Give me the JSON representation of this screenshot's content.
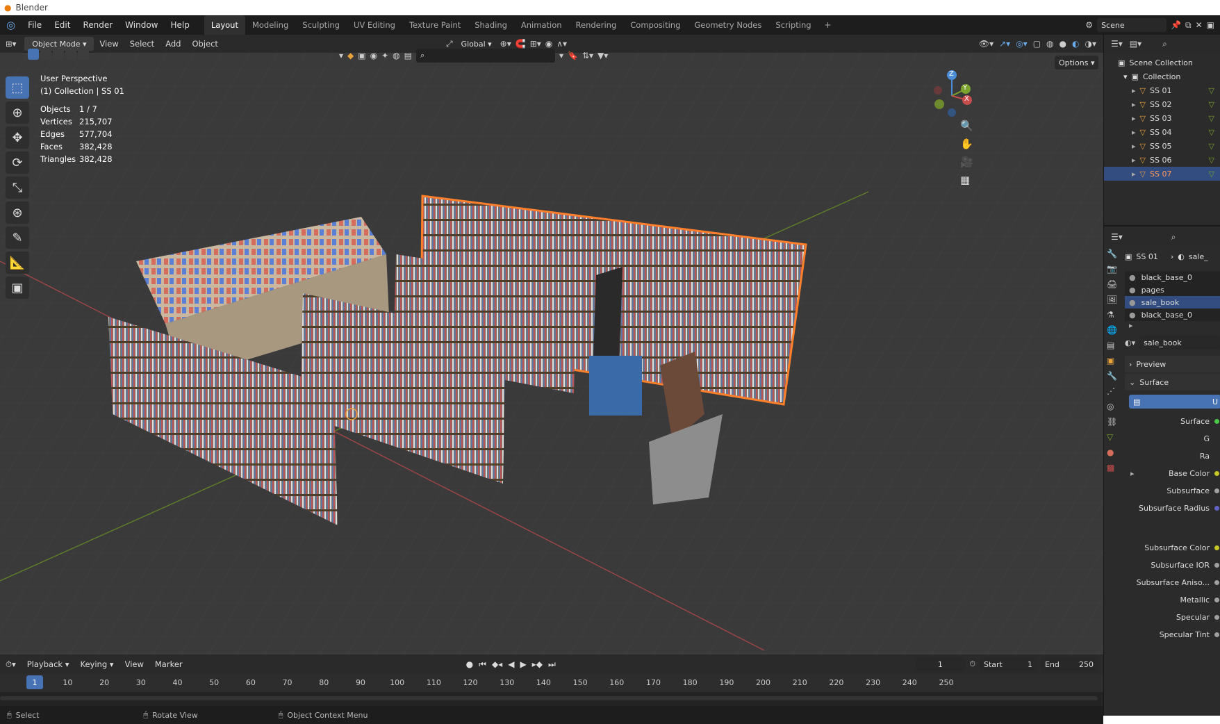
{
  "app_title": "Blender",
  "menu": [
    "File",
    "Edit",
    "Render",
    "Window",
    "Help"
  ],
  "workspaces": [
    "Layout",
    "Modeling",
    "Sculpting",
    "UV Editing",
    "Texture Paint",
    "Shading",
    "Animation",
    "Rendering",
    "Compositing",
    "Geometry Nodes",
    "Scripting"
  ],
  "active_workspace": "Layout",
  "scene_name": "Scene",
  "viewport_header": {
    "mode": "Object Mode",
    "menus": [
      "View",
      "Select",
      "Add",
      "Object"
    ],
    "orientation": "Global",
    "options": "Options"
  },
  "overlay": {
    "perspective": "User Perspective",
    "context": "(1) Collection | SS 01",
    "stats": [
      {
        "k": "Objects",
        "v": "1 / 7"
      },
      {
        "k": "Vertices",
        "v": "215,707"
      },
      {
        "k": "Edges",
        "v": "577,704"
      },
      {
        "k": "Faces",
        "v": "382,428"
      },
      {
        "k": "Triangles",
        "v": "382,428"
      }
    ]
  },
  "gizmo": {
    "z": "Z",
    "y": "Y",
    "x": "X"
  },
  "outliner": {
    "root": "Scene Collection",
    "collection": "Collection",
    "objects": [
      "SS 01",
      "SS 02",
      "SS 03",
      "SS 04",
      "SS 05",
      "SS 06",
      "SS 07"
    ],
    "selected": "SS 07"
  },
  "properties": {
    "breadcrumb_object": "SS 01",
    "breadcrumb_material": "sale_",
    "material_slots": [
      "black_base_0",
      "pages",
      "sale_book",
      "black_base_0"
    ],
    "active_slot": "sale_book",
    "material_name": "sale_book",
    "panels": {
      "preview": "Preview",
      "surface": "Surface"
    },
    "surface_field": "U",
    "inputs": [
      {
        "label": "Surface",
        "socket": "green"
      },
      {
        "label": "",
        "value": "G"
      },
      {
        "label": "",
        "value": "Ra"
      },
      {
        "label": "Base Color",
        "socket": "yellow"
      },
      {
        "label": "Subsurface",
        "socket": "gray"
      },
      {
        "label": "Subsurface Radius",
        "socket": "blue"
      },
      {
        "label": "Subsurface Color",
        "socket": "yellow"
      },
      {
        "label": "Subsurface IOR",
        "socket": "gray"
      },
      {
        "label": "Subsurface Aniso...",
        "socket": "gray"
      },
      {
        "label": "Metallic",
        "socket": "gray"
      },
      {
        "label": "Specular",
        "socket": "gray"
      },
      {
        "label": "Specular Tint",
        "socket": "gray"
      }
    ]
  },
  "timeline": {
    "menus": [
      "Playback",
      "Keying",
      "View",
      "Marker"
    ],
    "current_frame": "1",
    "start_label": "Start",
    "start": "1",
    "end_label": "End",
    "end": "250",
    "ticks": [
      "1",
      "10",
      "20",
      "30",
      "40",
      "50",
      "60",
      "70",
      "80",
      "90",
      "100",
      "110",
      "120",
      "130",
      "140",
      "150",
      "160",
      "170",
      "180",
      "190",
      "200",
      "210",
      "220",
      "230",
      "240",
      "250"
    ]
  },
  "statusbar": {
    "select": "Select",
    "rotate": "Rotate View",
    "context": "Object Context Menu"
  },
  "colors": {
    "accent": "#4772b3",
    "selection_outline": "#ff7f2a",
    "x_axis": "#c84c4c",
    "y_axis": "#7ca32b"
  }
}
